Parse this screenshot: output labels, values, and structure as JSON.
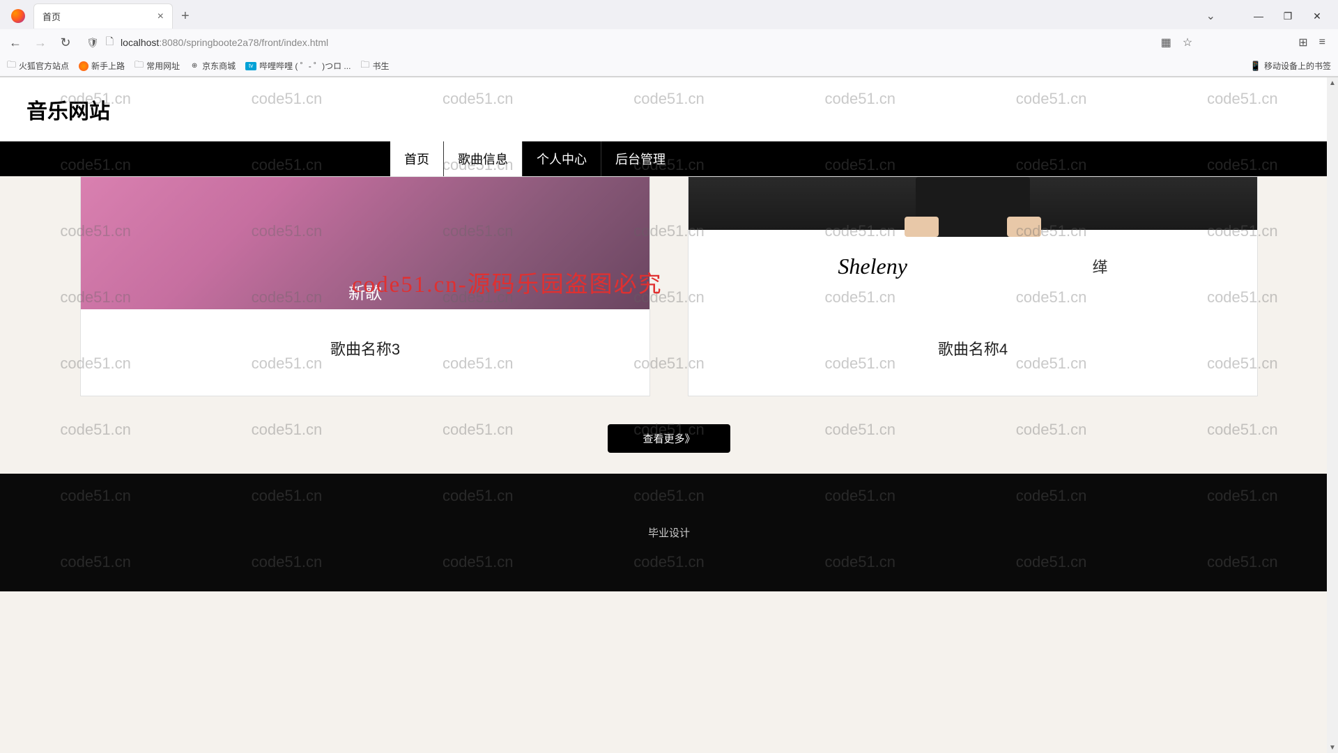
{
  "browser": {
    "tab_title": "首页",
    "url_host": "localhost",
    "url_path": ":8080/springboote2a78/front/index.html"
  },
  "bookmarks": {
    "b1": "火狐官方站点",
    "b2": "新手上路",
    "b3": "常用网址",
    "b4": "京东商城",
    "b5": "哔哩哔哩 ( ゜- ゜)つロ ...",
    "b6": "书生",
    "mobile": "移动设备上的书签"
  },
  "site": {
    "title": "音乐网站"
  },
  "nav": {
    "home": "首页",
    "songs": "歌曲信息",
    "personal": "个人中心",
    "admin": "后台管理"
  },
  "cards": [
    {
      "title": "歌曲名称3",
      "img_text": "新歌"
    },
    {
      "title": "歌曲名称4",
      "img_chinese": "缂"
    }
  ],
  "view_more": "查看更多》",
  "footer": "毕业设计",
  "watermark_text": "code51.cn",
  "big_watermark": "code51.cn-源码乐园盗图必究"
}
